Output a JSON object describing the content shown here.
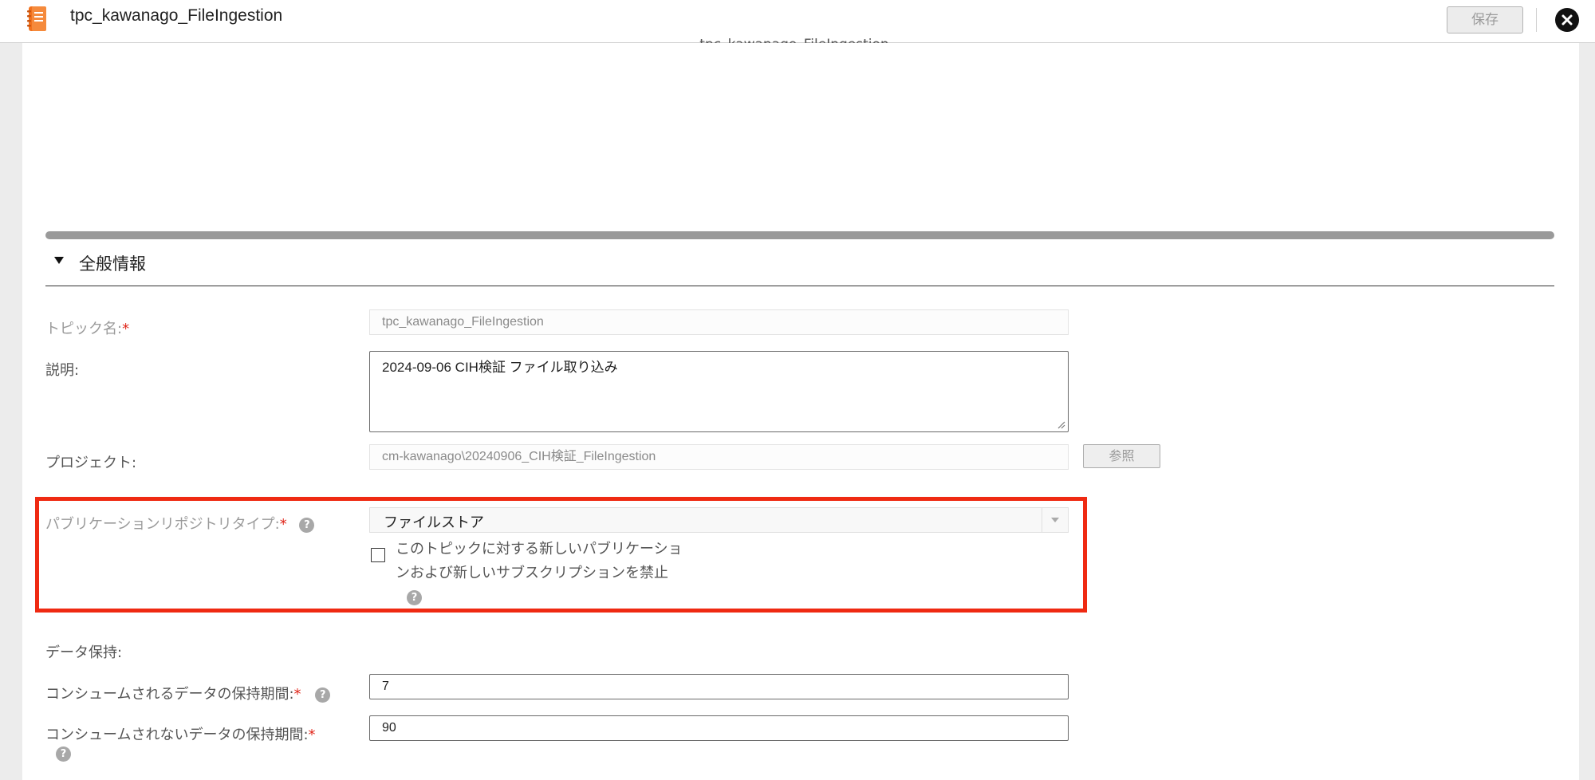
{
  "window": {
    "title": "tpc_kawanago_FileIngestion",
    "save_label": "保存",
    "app_icon": "orange-notebook-icon",
    "close_icon": "close-circle-icon"
  },
  "preview": {
    "caption": "tpc_kawanago_FileIngestion"
  },
  "section": {
    "title": "全般情報",
    "toggle_icon": "triangle-down-icon"
  },
  "form": {
    "topic_name": {
      "label": "トピック名:",
      "required": "*",
      "value": "tpc_kawanago_FileIngestion"
    },
    "description": {
      "label": "説明:",
      "value": "2024-09-06 CIH検証 ファイル取り込み"
    },
    "project": {
      "label": "プロジェクト:",
      "value": "cm-kawanago\\20240906_CIH検証_FileIngestion",
      "browse_label": "参照"
    },
    "publication_repo_type": {
      "label": "パブリケーションリポジトリタイプ:",
      "required": "*",
      "value": "ファイルストア",
      "help": "?"
    },
    "disable_new": {
      "label": "このトピックに対する新しいパブリケーションおよび新しいサブスクリプションを禁止",
      "checked": false,
      "help": "?"
    },
    "data_retention": {
      "label": "データ保持:"
    },
    "consumed_retention": {
      "label": "コンシュームされるデータの保持期間:",
      "required": "*",
      "value": "7",
      "help": "?"
    },
    "unconsumed_retention": {
      "label": "コンシュームされないデータの保持期間:",
      "required": "*",
      "value": "90",
      "help": "?"
    }
  },
  "colors": {
    "highlight": "#ef2a12",
    "required": "#e0261a",
    "icon_orange": "#f2711c"
  }
}
